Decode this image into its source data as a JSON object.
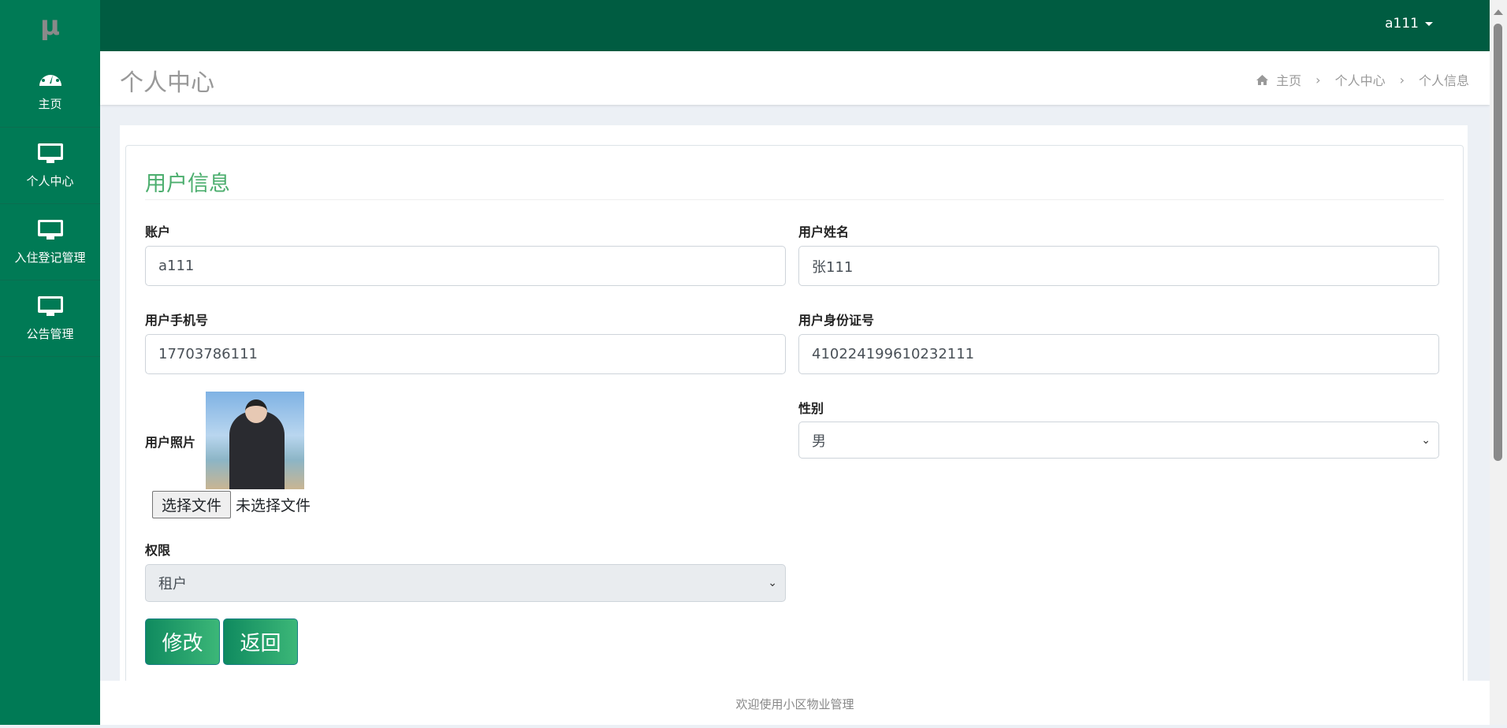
{
  "app": {
    "logo": "μ",
    "user": "a111"
  },
  "sidebar": {
    "items": [
      {
        "label": "主页",
        "icon": "dashboard-icon"
      },
      {
        "label": "个人中心",
        "icon": "monitor-icon"
      },
      {
        "label": "入住登记管理",
        "icon": "monitor-icon"
      },
      {
        "label": "公告管理",
        "icon": "monitor-icon"
      }
    ]
  },
  "header": {
    "title": "个人中心",
    "breadcrumb": [
      "主页",
      "个人中心",
      "个人信息"
    ]
  },
  "form": {
    "title": "用户信息",
    "account": {
      "label": "账户",
      "value": "a111"
    },
    "name": {
      "label": "用户姓名",
      "value": "张111"
    },
    "phone": {
      "label": "用户手机号",
      "value": "17703786111"
    },
    "idcard": {
      "label": "用户身份证号",
      "value": "410224199610232111"
    },
    "photo": {
      "label": "用户照片",
      "choose": "选择文件",
      "no_file": "未选择文件"
    },
    "gender": {
      "label": "性别",
      "value": "男"
    },
    "role": {
      "label": "权限",
      "value": "租户"
    },
    "buttons": {
      "edit": "修改",
      "back": "返回"
    }
  },
  "footer": {
    "text": "欢迎使用小区物业管理"
  }
}
